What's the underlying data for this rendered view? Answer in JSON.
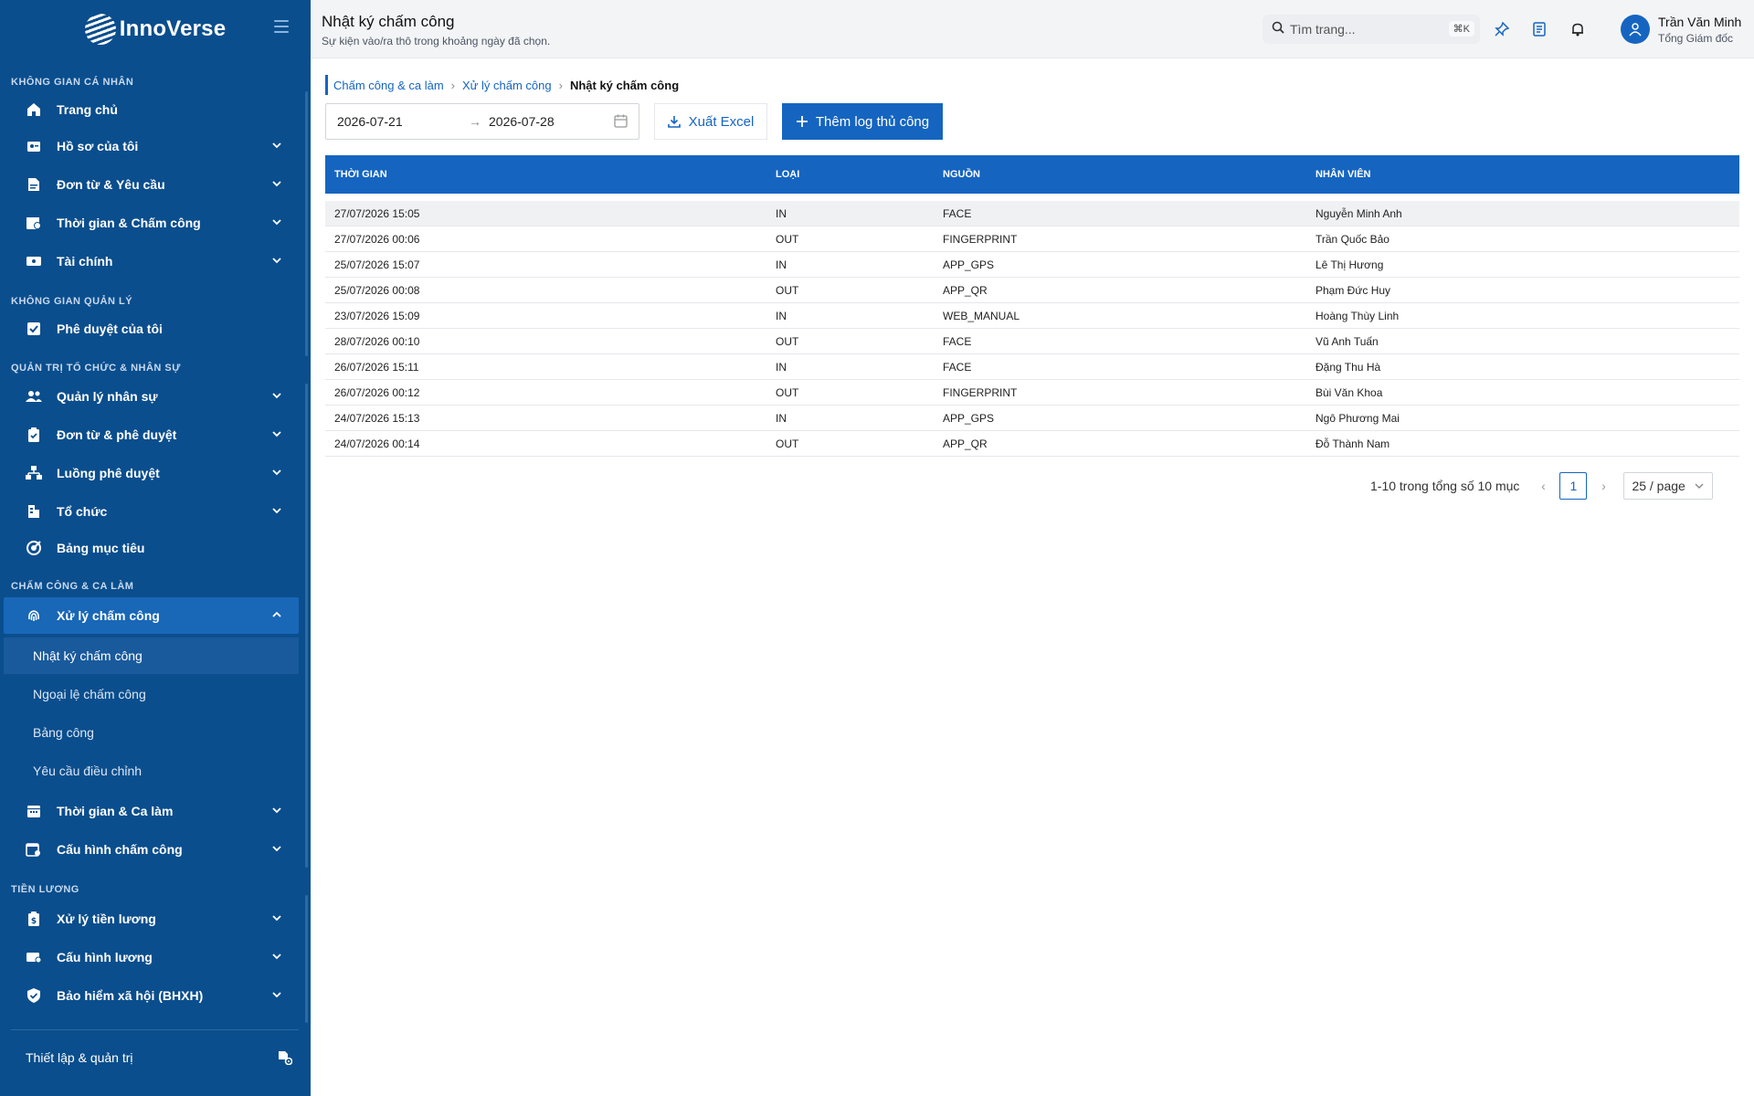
{
  "app": {
    "logo_text": "InnoVerse"
  },
  "sidebar": {
    "sections": {
      "personal": "KHÔNG GIAN CÁ NHÂN",
      "management": "KHÔNG GIAN QUẢN LÝ",
      "org_hr": "QUẢN TRỊ TỔ CHỨC & NHÂN SỰ",
      "attendance": "CHẤM CÔNG & CA LÀM",
      "payroll": "TIỀN LƯƠNG"
    },
    "items": {
      "home": "Trang chủ",
      "profile": "Hồ sơ của tôi",
      "requests": "Đơn từ & Yêu cầu",
      "time_attendance": "Thời gian & Chấm công",
      "finance": "Tài chính",
      "my_approvals": "Phê duyệt của tôi",
      "hr_management": "Quản lý nhân sự",
      "forms_approval": "Đơn từ & phê duyệt",
      "approval_flow": "Luồng phê duyệt",
      "organization": "Tổ chức",
      "goals": "Bảng mục tiêu",
      "attendance_processing": "Xử lý chấm công",
      "time_shift": "Thời gian & Ca làm",
      "attendance_config": "Cấu hình chấm công",
      "payroll_processing": "Xử lý tiền lương",
      "salary_config": "Cấu hình lương",
      "social_insurance": "Bảo hiểm xã hội (BHXH)"
    },
    "sub_items": {
      "attendance_log": "Nhật ký chấm công",
      "attendance_exceptions": "Ngoại lệ chấm công",
      "timesheet": "Bảng công",
      "adjust_requests": "Yêu cầu điều chỉnh"
    },
    "footer": "Thiết lập & quản trị"
  },
  "header": {
    "title": "Nhật ký chấm công",
    "subtitle": "Sự kiện vào/ra thô trong khoảng ngày đã chọn.",
    "search_placeholder": "Tìm trang...",
    "search_shortcut": "⌘K",
    "user_name": "Trần Văn Minh",
    "user_role": "Tổng Giám đốc"
  },
  "breadcrumb": [
    "Chấm công & ca làm",
    "Xử lý chấm công",
    "Nhật ký chấm công"
  ],
  "filters": {
    "date_from": "2026-07-21",
    "date_to": "2026-07-28",
    "range_separator": "→"
  },
  "actions": {
    "export": "Xuất Excel",
    "add_manual": "Thêm log thủ công"
  },
  "table": {
    "headers": [
      "THỜI GIAN",
      "LOẠI",
      "NGUỒN",
      "NHÂN VIÊN"
    ],
    "rows": [
      [
        "27/07/2026 15:05",
        "IN",
        "FACE",
        "Nguyễn Minh Anh"
      ],
      [
        "27/07/2026 00:06",
        "OUT",
        "FINGERPRINT",
        "Trần Quốc Bảo"
      ],
      [
        "25/07/2026 15:07",
        "IN",
        "APP_GPS",
        "Lê Thị Hương"
      ],
      [
        "25/07/2026 00:08",
        "OUT",
        "APP_QR",
        "Phạm Đức Huy"
      ],
      [
        "23/07/2026 15:09",
        "IN",
        "WEB_MANUAL",
        "Hoàng Thùy Linh"
      ],
      [
        "28/07/2026 00:10",
        "OUT",
        "FACE",
        "Vũ Anh Tuấn"
      ],
      [
        "26/07/2026 15:11",
        "IN",
        "FACE",
        "Đặng Thu Hà"
      ],
      [
        "26/07/2026 00:12",
        "OUT",
        "FINGERPRINT",
        "Bùi Văn Khoa"
      ],
      [
        "24/07/2026 15:13",
        "IN",
        "APP_GPS",
        "Ngô Phương Mai"
      ],
      [
        "24/07/2026 00:14",
        "OUT",
        "APP_QR",
        "Đỗ Thành Nam"
      ]
    ]
  },
  "pagination": {
    "summary": "1-10 trong tổng số 10 mục",
    "current_page": "1",
    "page_size": "25 / page"
  },
  "colors": {
    "sidebar_bg": "#0b4e8d",
    "accent": "#1565c0",
    "active_item": "#1967b7"
  }
}
